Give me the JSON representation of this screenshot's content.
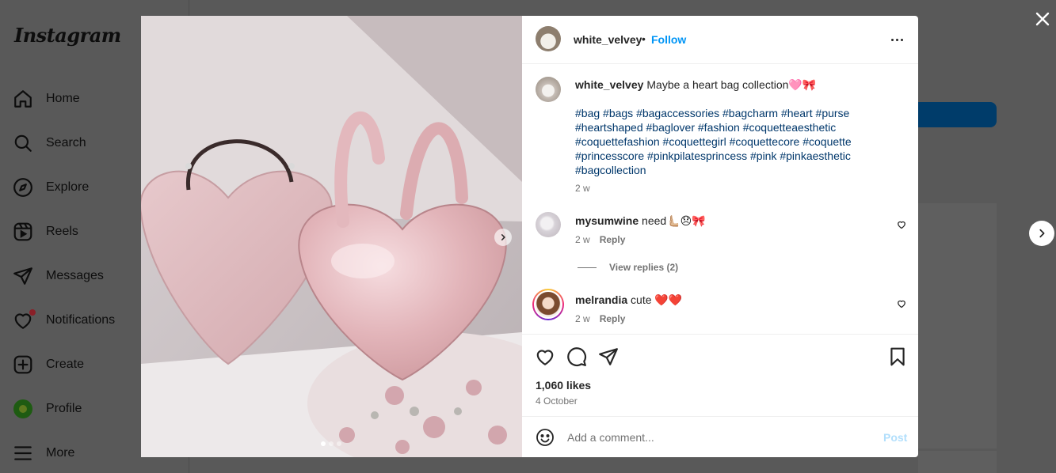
{
  "app": {
    "logo": "Instagram"
  },
  "sidebar": {
    "items": [
      {
        "label": "Home",
        "icon": "home-icon"
      },
      {
        "label": "Search",
        "icon": "search-icon"
      },
      {
        "label": "Explore",
        "icon": "compass-icon"
      },
      {
        "label": "Reels",
        "icon": "reels-icon"
      },
      {
        "label": "Messages",
        "icon": "paper-plane-icon"
      },
      {
        "label": "Notifications",
        "icon": "heart-icon"
      },
      {
        "label": "Create",
        "icon": "plus-square-icon"
      },
      {
        "label": "Profile",
        "icon": "profile-avatar"
      },
      {
        "label": "More",
        "icon": "hamburger-icon"
      }
    ]
  },
  "modal": {
    "close_icon": "close-icon",
    "next_post_icon": "chevron-right-icon",
    "carousel": {
      "slide_count": 3,
      "active_slide": 1
    },
    "header": {
      "username": "white_velvey",
      "separator": "•",
      "follow_label": "Follow",
      "more_icon": "more-options-icon"
    },
    "caption": {
      "username": "white_velvey",
      "text": "Maybe a heart bag collection🩷🎀",
      "hashtags": "#bag #bags #bagaccessories #bagcharm #heart #purse #heartshaped #baglover #fashion #coquetteaesthetic #coquettefashion #coquettegirl #coquettecore #coquette #princesscore #pinkpilatesprincess #pink #pinkaesthetic #bagcollection",
      "time": "2 w"
    },
    "comments": [
      {
        "username": "mysumwine",
        "text": "need🫷🏼😞🎀",
        "time": "2 w",
        "reply_label": "Reply"
      },
      {
        "username": "melrandia",
        "text": "cute ❤️❤️",
        "time": "2 w",
        "reply_label": "Reply"
      }
    ],
    "view_replies_label": "View replies (2)",
    "likes": "1,060 likes",
    "date": "4 October",
    "add_comment": {
      "placeholder": "Add a comment...",
      "post_label": "Post"
    },
    "colors": {
      "link": "#00376b",
      "follow": "#0095f6",
      "post_disabled": "#b2dffc"
    }
  }
}
